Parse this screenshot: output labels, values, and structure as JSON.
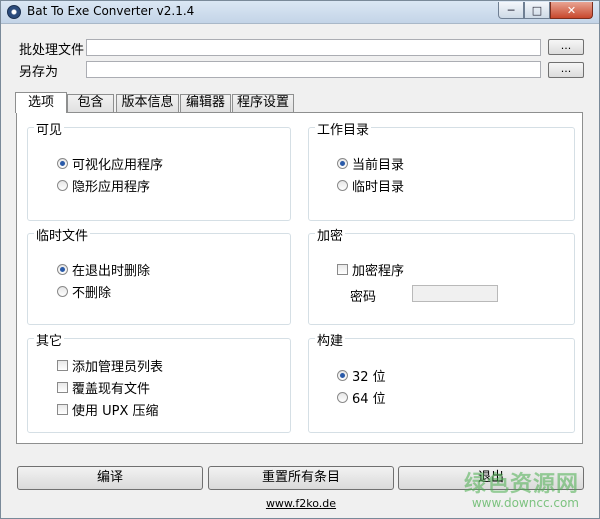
{
  "window": {
    "title": "Bat To Exe Converter v2.1.4",
    "controls": {
      "minimize": "─",
      "maximize": "□",
      "close": "✕"
    }
  },
  "file": {
    "batch_label": "批处理文件",
    "batch_value": "",
    "saveas_label": "另存为",
    "saveas_value": "",
    "browse_label": "..."
  },
  "tabs": [
    {
      "label": "选项",
      "active": true
    },
    {
      "label": "包含"
    },
    {
      "label": "版本信息"
    },
    {
      "label": "编辑器"
    },
    {
      "label": "程序设置"
    }
  ],
  "groups": {
    "visible": {
      "title": "可见",
      "options": [
        {
          "label": "可视化应用程序",
          "checked": true
        },
        {
          "label": "隐形应用程序",
          "checked": false
        }
      ]
    },
    "workdir": {
      "title": "工作目录",
      "options": [
        {
          "label": "当前目录",
          "checked": true
        },
        {
          "label": "临时目录",
          "checked": false
        }
      ]
    },
    "tempfile": {
      "title": "临时文件",
      "options": [
        {
          "label": "在退出时删除",
          "checked": true
        },
        {
          "label": "不删除",
          "checked": false
        }
      ]
    },
    "encrypt": {
      "title": "加密",
      "checkbox": "加密程序",
      "password_label": "密码"
    },
    "other": {
      "title": "其它",
      "checkboxes": [
        {
          "label": "添加管理员列表",
          "checked": false
        },
        {
          "label": "覆盖现有文件",
          "checked": false
        },
        {
          "label": "使用 UPX 压缩",
          "checked": false
        }
      ]
    },
    "build": {
      "title": "构建",
      "options": [
        {
          "label": "32 位",
          "checked": true
        },
        {
          "label": "64 位",
          "checked": false
        }
      ]
    }
  },
  "buttons": {
    "compile": "编译",
    "reset": "重置所有条目",
    "exit": "退出"
  },
  "footer": {
    "link": "www.f2ko.de"
  },
  "watermark": {
    "line1": "绿色资源网",
    "line2": "www.downcc.com"
  }
}
